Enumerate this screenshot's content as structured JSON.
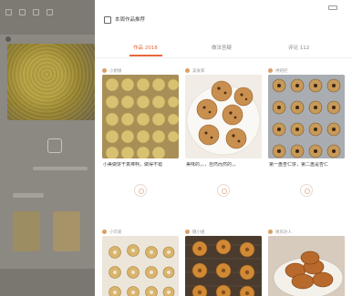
{
  "panel": {
    "header": {
      "title": "本周作品推荐"
    },
    "tabs": [
      {
        "label": "作品 2018"
      },
      {
        "label": "做法答疑"
      },
      {
        "label": "评论 112"
      }
    ],
    "cards": [
      {
        "author": "小厨娘",
        "caption": "小美做饼干真棒啊，做得不错",
        "meta": ""
      },
      {
        "author": "美食家",
        "caption": "美味的，，，自然而然的，，",
        "meta": ""
      },
      {
        "author": "烘焙控",
        "caption": "第一盘杏仁饼，第二盘是杏仁",
        "meta": ""
      },
      {
        "author": "小可爱",
        "caption": "",
        "meta": ""
      },
      {
        "author": "糖小姐",
        "caption": "",
        "meta": ""
      },
      {
        "author": "厨房达人",
        "caption": "",
        "meta": ""
      }
    ]
  },
  "colors": {
    "accent": "#e8673a"
  }
}
